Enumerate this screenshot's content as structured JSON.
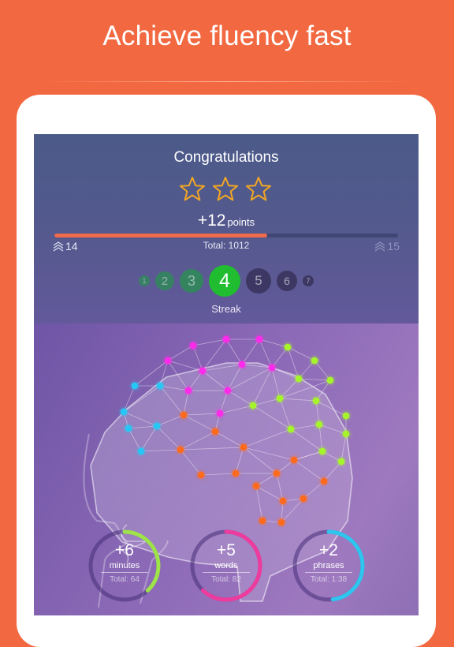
{
  "headline": "Achieve fluency fast",
  "results": {
    "title": "Congratulations",
    "stars": {
      "earned": 3,
      "total": 3,
      "color": "#f2a623"
    },
    "points": {
      "value": "+12",
      "unit": "points"
    },
    "level_progress": {
      "fraction": 0.62,
      "fill_color": "#ef6a4a"
    },
    "current_level": "14",
    "next_level": "15",
    "total_points": "Total: 1012",
    "streak": {
      "label": "Streak",
      "days": [
        "1",
        "2",
        "3",
        "4",
        "5",
        "6",
        "7"
      ],
      "current": 4,
      "active_color": "#1fbd2f",
      "past_color": "#2e8c57",
      "future_color": "#3d3763"
    }
  },
  "stats": [
    {
      "value": "+6",
      "label": "minutes",
      "total": "Total: 64",
      "fraction": 0.38,
      "color": "#9ee34a"
    },
    {
      "value": "+5",
      "label": "words",
      "total": "Total: 82",
      "fraction": 0.62,
      "color": "#ee3b9e"
    },
    {
      "value": "+2",
      "label": "phrases",
      "total": "Total: 1:38",
      "fraction": 0.48,
      "color": "#2ec6ef"
    }
  ],
  "brain_nodes": {
    "colors": {
      "blue": "#27c7f5",
      "magenta": "#ff2bea",
      "green": "#a6f52a",
      "orange": "#ff6a1e"
    }
  }
}
